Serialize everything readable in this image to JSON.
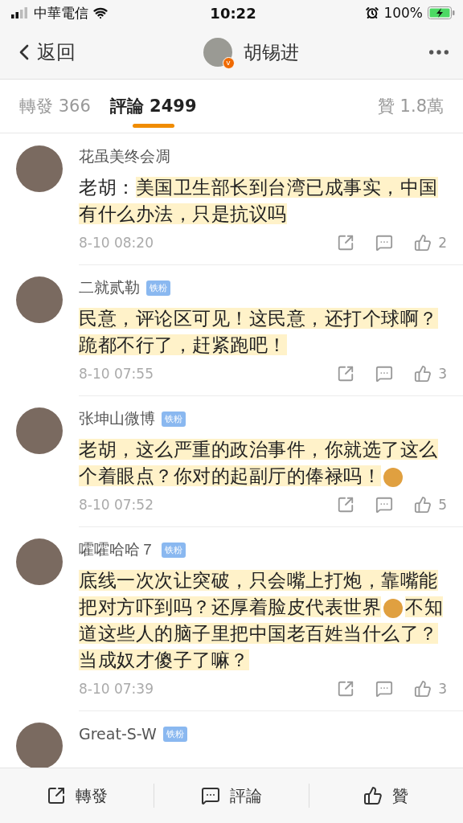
{
  "status_bar": {
    "carrier": "中華電信",
    "time": "10:22",
    "battery": "100%"
  },
  "nav": {
    "back": "返回",
    "title": "胡锡进",
    "verified_mark": "v"
  },
  "tabs": [
    {
      "label": "轉發 366",
      "selected": false
    },
    {
      "label": "評論 2499",
      "selected": true
    }
  ],
  "likes_total": "贊 1.8萬",
  "comments": [
    {
      "user": "花虽美终会凋",
      "segments": [
        {
          "kind": "text",
          "text": "老胡：",
          "highlighted": false
        },
        {
          "kind": "text",
          "text": "美国卫生部长到台湾已成事实，中国有什么办法，只是抗议吗",
          "highlighted": true
        }
      ],
      "time": "8-10 08:20",
      "likes": "2"
    },
    {
      "user": "二就贰勒",
      "badge": "铁粉",
      "segments": [
        {
          "kind": "text",
          "text": "民意，评论区可见！这民意，还打个球啊？跪都不行了，赶紧跑吧！",
          "highlighted": true
        }
      ],
      "time": "8-10 07:55",
      "likes": "3"
    },
    {
      "user": "张坤山微博",
      "badge": "铁粉",
      "segments": [
        {
          "kind": "text",
          "text": "老胡，这么严重的政治事件，你就选了这么个着眼点？你对的起副厅的俸禄吗！",
          "highlighted": true
        },
        {
          "kind": "emoji"
        }
      ],
      "time": "8-10 07:52",
      "likes": "5"
    },
    {
      "user": "嚯嚯哈哈７",
      "badge": "铁粉",
      "segments": [
        {
          "kind": "text",
          "text": "底线一次次让突破，只会嘴上打炮，靠嘴能把对方吓到吗？还厚着脸皮代表世界",
          "highlighted": true
        },
        {
          "kind": "emoji"
        },
        {
          "kind": "text",
          "text": "不知道这些人的脑子里把中国老百姓当什么了？当成奴才傻子了嘛？",
          "highlighted": true
        }
      ],
      "time": "8-10 07:39",
      "likes": "3"
    },
    {
      "user": "Great-S-W",
      "badge": "铁粉"
    }
  ],
  "bottom_bar": [
    {
      "kind": "repost",
      "label": "轉發"
    },
    {
      "kind": "comment",
      "label": "評論"
    },
    {
      "kind": "like",
      "label": "贊"
    }
  ]
}
